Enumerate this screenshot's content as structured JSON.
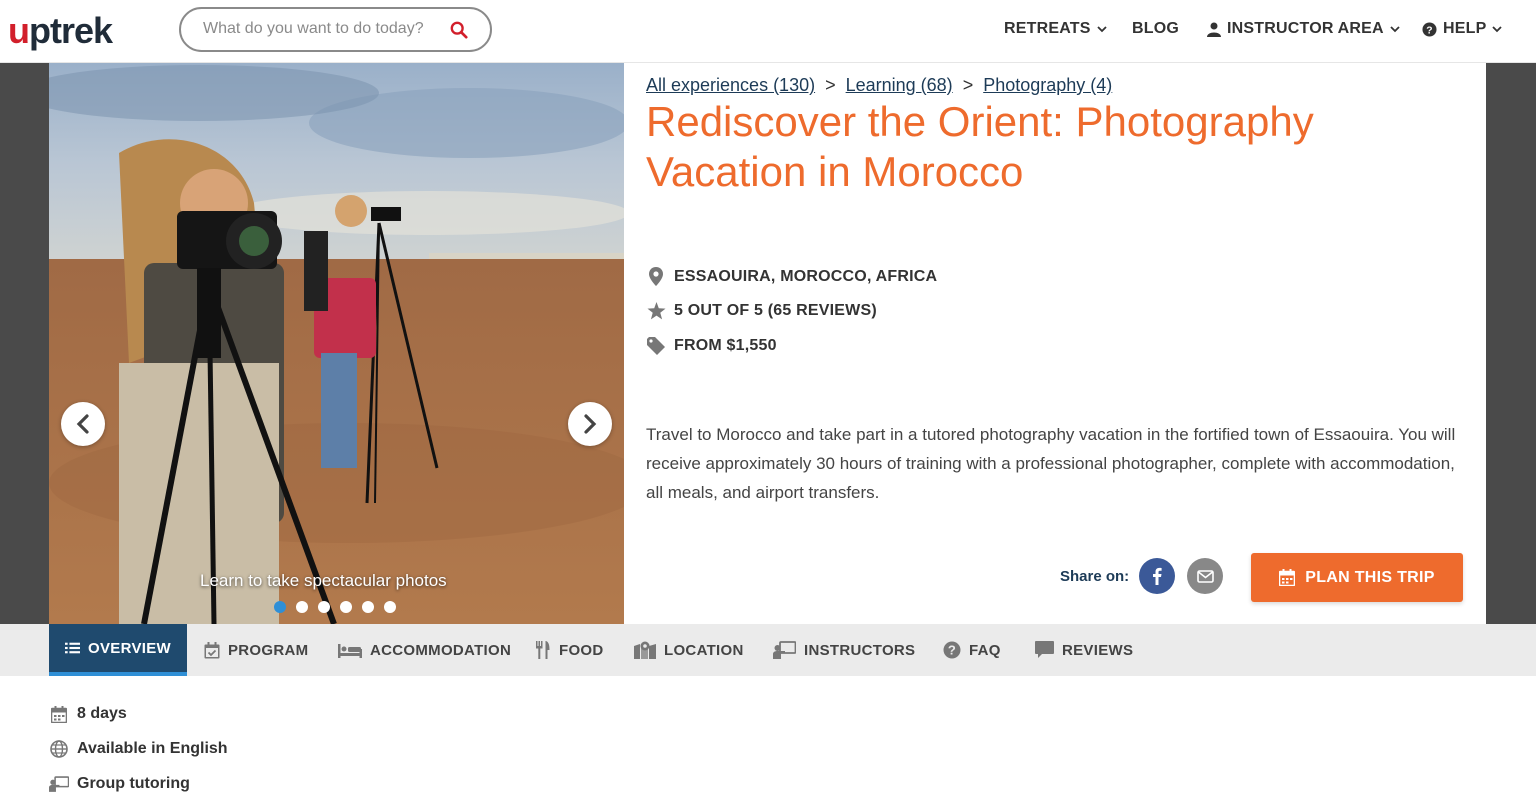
{
  "header": {
    "logo_u": "u",
    "logo_rest": "ptrek",
    "search_placeholder": "What do you want to do today?",
    "nav": {
      "retreats": "RETREATS",
      "blog": "BLOG",
      "instructor_area": "INSTRUCTOR AREA",
      "help": "HELP"
    }
  },
  "hero": {
    "caption": "Learn to take spectacular photos",
    "slides_count": 6,
    "active_slide": 1
  },
  "breadcrumbs": [
    {
      "label": "All experiences (130)"
    },
    {
      "label": "Learning (68)"
    },
    {
      "label": "Photography (4)"
    }
  ],
  "breadcrumb_sep": ">",
  "title": "Rediscover the Orient: Photography Vacation in Morocco",
  "meta": {
    "location": "ESSAOUIRA, MOROCCO, AFRICA",
    "rating": "5 OUT OF 5 (65 REVIEWS)",
    "price": "FROM $1,550"
  },
  "description": "Travel to Morocco and take part in a tutored photography vacation in the fortified town of Essaouira. You will receive approximately 30 hours of training with a professional photographer, complete with accommodation, all meals, and airport transfers.",
  "share": {
    "label": "Share on:"
  },
  "cta": {
    "plan_label": "PLAN THIS TRIP"
  },
  "tabs": [
    {
      "label": "OVERVIEW",
      "icon": "list-icon",
      "active": true
    },
    {
      "label": "PROGRAM",
      "icon": "calendar-check-icon"
    },
    {
      "label": "ACCOMMODATION",
      "icon": "bed-icon"
    },
    {
      "label": "FOOD",
      "icon": "utensils-icon"
    },
    {
      "label": "LOCATION",
      "icon": "map-pin-icon"
    },
    {
      "label": "INSTRUCTORS",
      "icon": "chalkboard-teacher-icon"
    },
    {
      "label": "FAQ",
      "icon": "question-circle-icon"
    },
    {
      "label": "REVIEWS",
      "icon": "comment-icon"
    }
  ],
  "facts": {
    "duration": "8 days",
    "language": "Available in English",
    "tutoring": "Group tutoring"
  },
  "colors": {
    "accent": "#ee6b2d",
    "navy": "#1f4a6e",
    "brand_red": "#d21f2b",
    "facebook": "#3b5998",
    "dot_active": "#2f8fd6"
  }
}
